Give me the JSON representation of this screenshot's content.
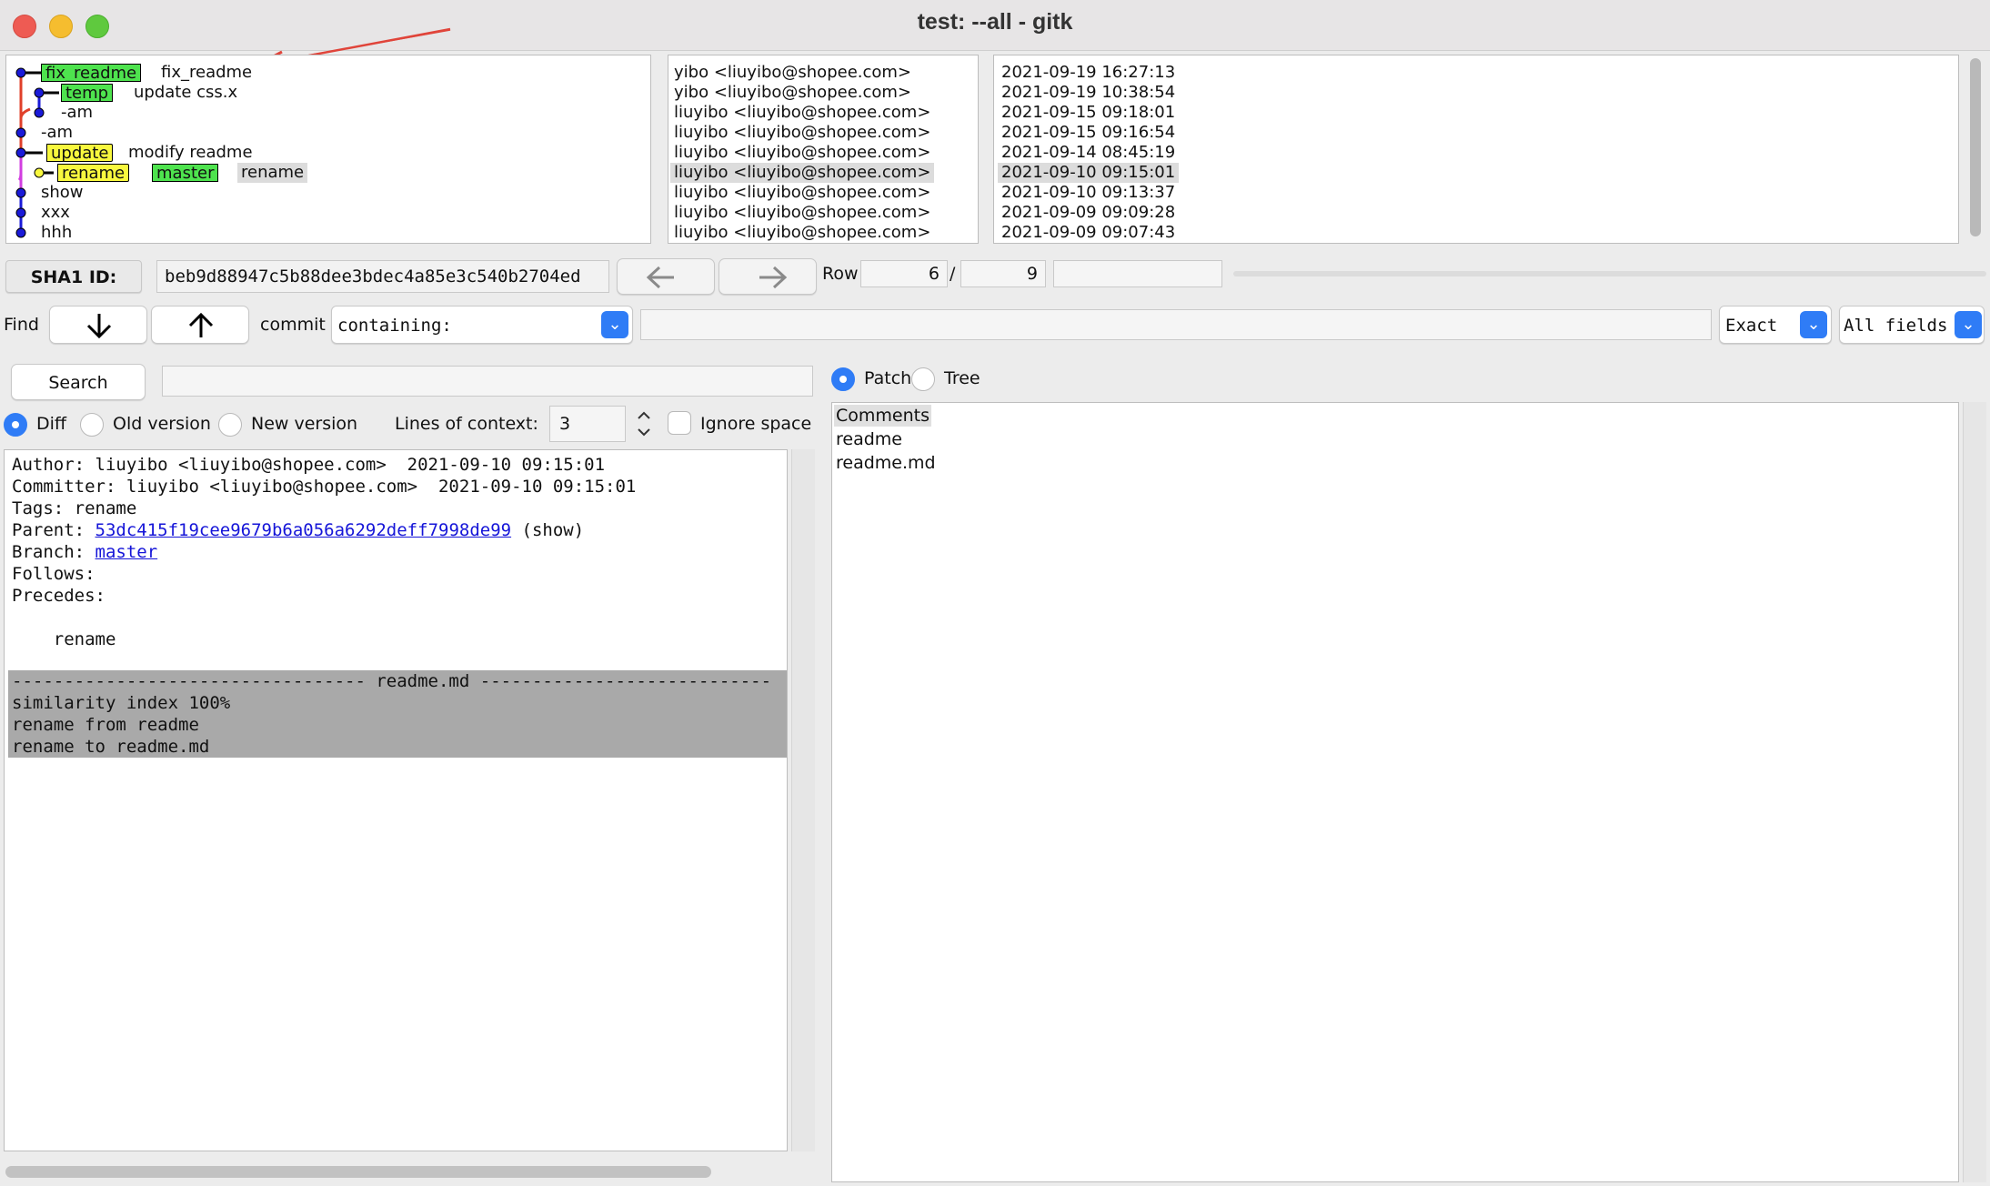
{
  "window": {
    "title": "test: --all - gitk"
  },
  "graph": {
    "rows": [
      {
        "badges": [
          {
            "text": "fix_readme",
            "color": "green"
          }
        ],
        "subject": "fix_readme",
        "selected": false
      },
      {
        "badges": [
          {
            "text": "temp",
            "color": "green"
          }
        ],
        "subject": "update css.x",
        "selected": false
      },
      {
        "badges": [],
        "subject": "-am",
        "selected": false
      },
      {
        "badges": [],
        "subject": "-am",
        "selected": false
      },
      {
        "badges": [
          {
            "text": "update",
            "color": "yellow"
          }
        ],
        "subject": "modify readme",
        "selected": false
      },
      {
        "badges": [
          {
            "text": "rename",
            "color": "yellow"
          },
          {
            "text": "master",
            "color": "green"
          }
        ],
        "subject": "rename",
        "selected": true
      },
      {
        "badges": [],
        "subject": "show",
        "selected": false
      },
      {
        "badges": [],
        "subject": "xxx",
        "selected": false
      },
      {
        "badges": [],
        "subject": "hhh",
        "selected": false
      }
    ]
  },
  "authors": [
    "yibo <liuyibo@shopee.com>",
    "yibo <liuyibo@shopee.com>",
    "liuyibo <liuyibo@shopee.com>",
    "liuyibo <liuyibo@shopee.com>",
    "liuyibo <liuyibo@shopee.com>",
    "liuyibo <liuyibo@shopee.com>",
    "liuyibo <liuyibo@shopee.com>",
    "liuyibo <liuyibo@shopee.com>",
    "liuyibo <liuyibo@shopee.com>"
  ],
  "dates": [
    "2021-09-19 16:27:13",
    "2021-09-19 10:38:54",
    "2021-09-15 09:18:01",
    "2021-09-15 09:16:54",
    "2021-09-14 08:45:19",
    "2021-09-10 09:15:01",
    "2021-09-10 09:13:37",
    "2021-09-09 09:09:28",
    "2021-09-09 09:07:43"
  ],
  "sha": {
    "label": "SHA1 ID:",
    "value": "beb9d88947c5b88dee3bdec4a85e3c540b2704ed"
  },
  "row": {
    "label": "Row",
    "current": "6",
    "separator": "/",
    "total": "9"
  },
  "find": {
    "label": "Find",
    "commit_label": "commit",
    "type_value": "containing:",
    "match_value": "Exact",
    "fields_value": "All fields"
  },
  "search": {
    "button": "Search",
    "diff_label": "Diff",
    "old_label": "Old version",
    "new_label": "New version",
    "context_label": "Lines of context:",
    "context_value": "3",
    "ignore_label": "Ignore space c"
  },
  "detail": {
    "author": "Author: liuyibo <liuyibo@shopee.com>  2021-09-10 09:15:01",
    "committer": "Committer: liuyibo <liuyibo@shopee.com>  2021-09-10 09:15:01",
    "tags": "Tags: rename",
    "parent_prefix": "Parent: ",
    "parent_hash": "53dc415f19cee9679b6a056a6292deff7998de99",
    "parent_suffix": " (show)",
    "branch_prefix": "Branch: ",
    "branch_name": "master",
    "follows": "Follows:",
    "precedes": "Precedes:",
    "message": "    rename",
    "diff_header": "---------------------------------- readme.md ----------------------------",
    "diff_lines": [
      "similarity index 100%",
      "rename from readme",
      "rename to readme.md"
    ]
  },
  "files": {
    "patch_label": "Patch",
    "tree_label": "Tree",
    "items": [
      "Comments",
      "readme",
      "readme.md"
    ]
  },
  "colors": {
    "accent": "#2f7cf6",
    "ref_green": "#4ee34e",
    "ref_yellow": "#f8f83e",
    "annotation_arrow": "#e0443a",
    "graph_blue": "#1a1ad8",
    "graph_red": "#e0402a",
    "graph_magenta": "#d23ee0"
  }
}
